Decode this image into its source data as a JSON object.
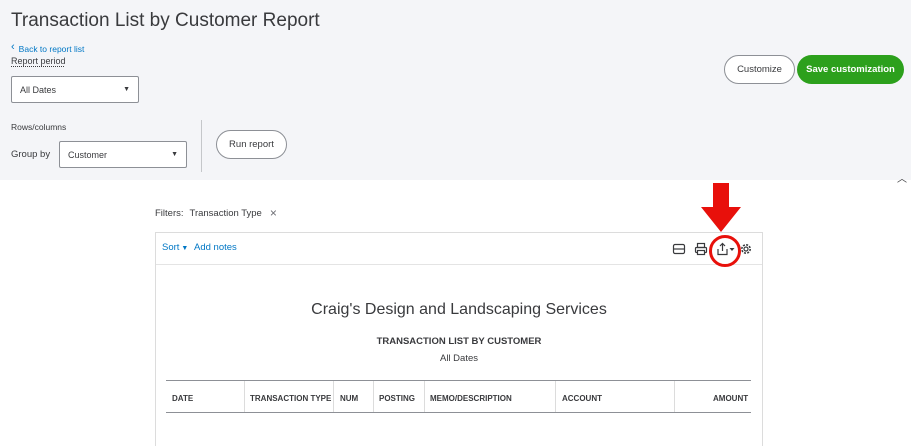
{
  "header": {
    "title": "Transaction List by Customer Report",
    "back_link": "Back to report list",
    "customize_label": "Customize",
    "save_label": "Save customization"
  },
  "controls": {
    "report_period_label": "Report period",
    "report_period_value": "All Dates",
    "rows_columns_label": "Rows/columns",
    "group_by_label": "Group by",
    "group_by_value": "Customer",
    "run_report_label": "Run report"
  },
  "filters": {
    "label": "Filters:",
    "items": [
      "Transaction Type"
    ]
  },
  "toolbar": {
    "sort_label": "Sort",
    "add_notes_label": "Add notes",
    "icons": [
      "email-icon",
      "print-icon",
      "export-icon",
      "settings-icon"
    ]
  },
  "report": {
    "company": "Craig's Design and Landscaping Services",
    "title": "TRANSACTION LIST BY CUSTOMER",
    "period": "All Dates",
    "columns": [
      "DATE",
      "TRANSACTION TYPE",
      "NUM",
      "POSTING",
      "MEMO/DESCRIPTION",
      "ACCOUNT",
      "AMOUNT"
    ]
  },
  "colors": {
    "accent_green": "#2ca01c",
    "link_blue": "#0077c5",
    "highlight_red": "#e8100b",
    "panel_bg": "#f4f5f8"
  }
}
